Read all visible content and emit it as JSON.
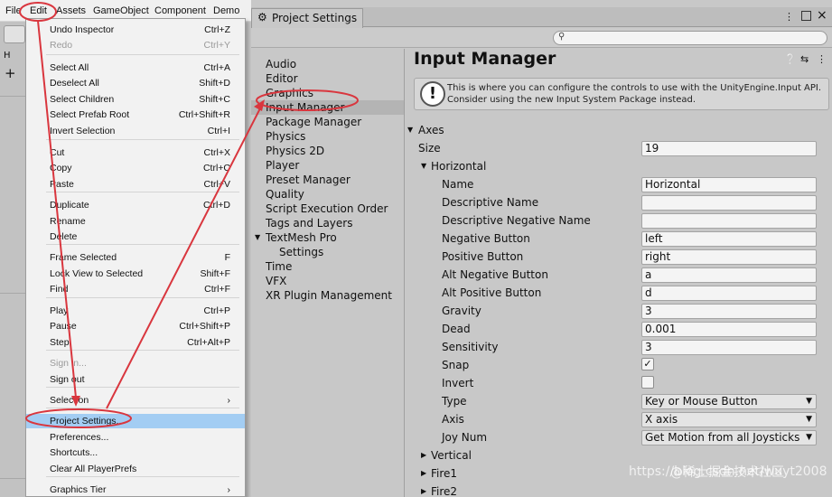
{
  "menubar": {
    "items": [
      "File",
      "Edit",
      "Assets",
      "GameObject",
      "Component",
      "Demo"
    ]
  },
  "background": {
    "hierarchy_tab": "H",
    "plus": "+"
  },
  "edit_menu": {
    "items": [
      {
        "label": "Undo Inspector",
        "shortcut": "Ctrl+Z"
      },
      {
        "label": "Redo",
        "shortcut": "Ctrl+Y"
      },
      {
        "label": "Select All",
        "shortcut": "Ctrl+A"
      },
      {
        "label": "Deselect All",
        "shortcut": "Shift+D"
      },
      {
        "label": "Select Children",
        "shortcut": "Shift+C"
      },
      {
        "label": "Select Prefab Root",
        "shortcut": "Ctrl+Shift+R"
      },
      {
        "label": "Invert Selection",
        "shortcut": "Ctrl+I"
      },
      {
        "label": "Cut",
        "shortcut": "Ctrl+X"
      },
      {
        "label": "Copy",
        "shortcut": "Ctrl+C"
      },
      {
        "label": "Paste",
        "shortcut": "Ctrl+V"
      },
      {
        "label": "Duplicate",
        "shortcut": "Ctrl+D"
      },
      {
        "label": "Rename",
        "shortcut": ""
      },
      {
        "label": "Delete",
        "shortcut": ""
      },
      {
        "label": "Frame Selected",
        "shortcut": "F"
      },
      {
        "label": "Lock View to Selected",
        "shortcut": "Shift+F"
      },
      {
        "label": "Find",
        "shortcut": "Ctrl+F"
      },
      {
        "label": "Play",
        "shortcut": "Ctrl+P"
      },
      {
        "label": "Pause",
        "shortcut": "Ctrl+Shift+P"
      },
      {
        "label": "Step",
        "shortcut": "Ctrl+Alt+P"
      },
      {
        "label": "Sign in...",
        "shortcut": ""
      },
      {
        "label": "Sign out",
        "shortcut": ""
      },
      {
        "label": "Selection",
        "shortcut": "›"
      },
      {
        "label": "Project Settings...",
        "shortcut": ""
      },
      {
        "label": "Preferences...",
        "shortcut": ""
      },
      {
        "label": "Shortcuts...",
        "shortcut": ""
      },
      {
        "label": "Clear All PlayerPrefs",
        "shortcut": ""
      },
      {
        "label": "Graphics Tier",
        "shortcut": "›"
      }
    ]
  },
  "window": {
    "tab_title": "Project Settings",
    "tab_icon": "gear-icon",
    "controls": {
      "menu": "⋮",
      "close": "×"
    }
  },
  "sidebar": {
    "items": [
      "Audio",
      "Editor",
      "Graphics",
      "Input Manager",
      "Package Manager",
      "Physics",
      "Physics 2D",
      "Player",
      "Preset Manager",
      "Quality",
      "Script Execution Order",
      "Tags and Layers",
      "TextMesh Pro",
      "Settings",
      "Time",
      "VFX",
      "XR Plugin Management"
    ],
    "selected": "Input Manager"
  },
  "main": {
    "title": "Input Manager",
    "help_text": "This is where you can configure the controls to use with the UnityEngine.Input API. Consider using the new Input System Package instead.",
    "axes_label": "Axes",
    "size_label": "Size",
    "size_value": "19",
    "horizontal": {
      "label": "Horizontal",
      "name_label": "Name",
      "name_value": "Horizontal",
      "desc_label": "Descriptive Name",
      "desc_value": "",
      "desc_neg_label": "Descriptive Negative Name",
      "desc_neg_value": "",
      "neg_label": "Negative Button",
      "neg_value": "left",
      "pos_label": "Positive Button",
      "pos_value": "right",
      "alt_neg_label": "Alt Negative Button",
      "alt_neg_value": "a",
      "alt_pos_label": "Alt Positive Button",
      "alt_pos_value": "d",
      "gravity_label": "Gravity",
      "gravity_value": "3",
      "dead_label": "Dead",
      "dead_value": "0.001",
      "sensitivity_label": "Sensitivity",
      "sensitivity_value": "3",
      "snap_label": "Snap",
      "snap_checked": true,
      "invert_label": "Invert",
      "invert_checked": false,
      "type_label": "Type",
      "type_value": "Key or Mouse Button",
      "axis_label": "Axis",
      "axis_value": "X axis",
      "joy_label": "Joy Num",
      "joy_value": "Get Motion from all Joysticks"
    },
    "collapsed": [
      "Vertical",
      "Fire1",
      "Fire2"
    ]
  },
  "watermark": "https://blog.csdn.net/wuyt2008",
  "watermark_site": "@稀土掘金技术社区",
  "colors": {
    "annotation": "#d9363e",
    "highlight": "#a3cdf3"
  }
}
